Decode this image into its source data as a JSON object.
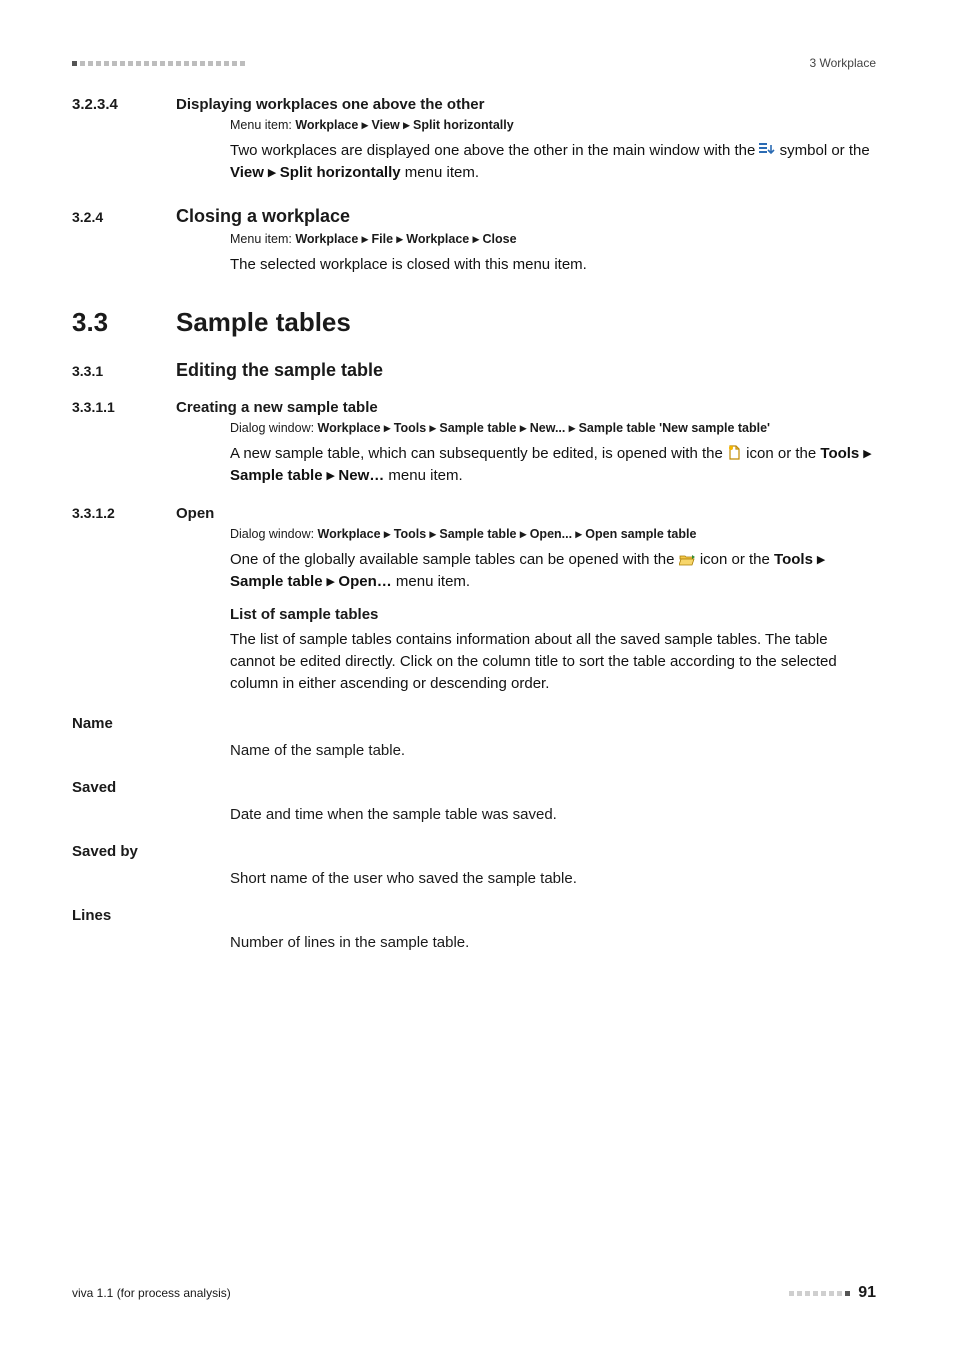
{
  "header": {
    "right": "3 Workplace"
  },
  "s_3_2_3_4": {
    "num": "3.2.3.4",
    "title": "Displaying workplaces one above the other",
    "menu_lead": "Menu item: ",
    "menu_path": "Workplace ▸ View ▸ Split horizontally",
    "para1_a": "Two workplaces are displayed one above the other in the main window with the ",
    "para1_b": " symbol or the ",
    "para1_bold": "View ▸ Split horizontally",
    "para1_c": " menu item."
  },
  "s_3_2_4": {
    "num": "3.2.4",
    "title": "Closing a workplace",
    "menu_lead": "Menu item: ",
    "menu_path": "Workplace ▸ File ▸ Workplace ▸ Close",
    "para": "The selected workplace is closed with this menu item."
  },
  "s_3_3": {
    "num": "3.3",
    "title": "Sample tables"
  },
  "s_3_3_1": {
    "num": "3.3.1",
    "title": "Editing the sample table"
  },
  "s_3_3_1_1": {
    "num": "3.3.1.1",
    "title": "Creating a new sample table",
    "menu_lead": "Dialog window: ",
    "menu_path": "Workplace ▸ Tools ▸ Sample table ▸ New... ▸ Sample table 'New sample table'",
    "para_a": "A new sample table, which can subsequently be edited, is opened with the ",
    "para_b": " icon or the ",
    "para_bold": "Tools ▸ Sample table ▸ New…",
    "para_c": " menu item."
  },
  "s_3_3_1_2": {
    "num": "3.3.1.2",
    "title": "Open",
    "menu_lead": "Dialog window: ",
    "menu_path": "Workplace ▸ Tools ▸ Sample table ▸ Open... ▸ Open sample table",
    "para_a": "One of the globally available sample tables can be opened with the ",
    "para_b": " icon or the ",
    "para_bold": "Tools ▸ Sample table ▸ Open…",
    "para_c": " menu item.",
    "list_heading": "List of sample tables",
    "list_para": "The list of sample tables contains information about all the saved sample tables. The table cannot be edited directly. Click on the column title to sort the table according to the selected column in either ascending or descending order.",
    "fields": {
      "name_label": "Name",
      "name_desc": "Name of the sample table.",
      "saved_label": "Saved",
      "saved_desc": "Date and time when the sample table was saved.",
      "savedby_label": "Saved by",
      "savedby_desc": "Short name of the user who saved the sample table.",
      "lines_label": "Lines",
      "lines_desc": "Number of lines in the sample table."
    }
  },
  "footer": {
    "left": "viva 1.1 (for process analysis)",
    "pagenum": "91"
  }
}
